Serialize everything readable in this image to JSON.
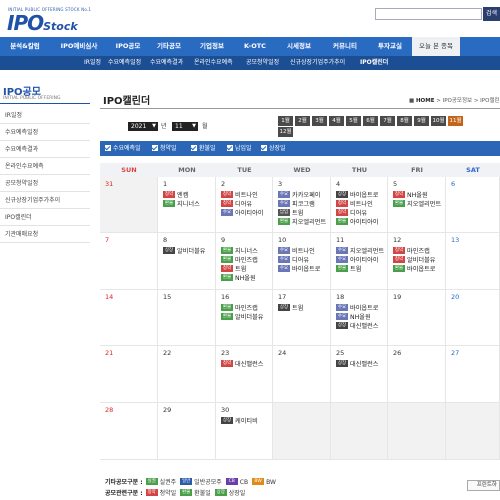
{
  "header": {
    "logo_tag": "INITIAL PUBLIC OFFERING STOCK No.1",
    "logo_ipo": "IPO",
    "logo_stock": "Stock",
    "search_button": "검색"
  },
  "nav": {
    "items": [
      "분석&칼럼",
      "IPO예비심사",
      "IPO공모",
      "기타공모",
      "기업정보",
      "K-OTC",
      "시세정보",
      "커뮤니티",
      "투자교실"
    ],
    "today_label": "오늘 본 종목"
  },
  "subnav": {
    "items": [
      "IR일정",
      "수요예측일정",
      "수요예측결과",
      "온라인수요예측",
      "공모청약일정",
      "신규상장기업주가추이",
      "IPO캘린더"
    ],
    "active_index": 6
  },
  "sidebar": {
    "title": "IPO공모",
    "subtitle": "INITIAL PUBLIC OFFERING",
    "items": [
      "IR일정",
      "수요예측일정",
      "수요예측결과",
      "온라인수요예측",
      "공모청약일정",
      "신규상장기업주가추이",
      "IPO캘린더",
      "기관매매요청"
    ]
  },
  "page": {
    "title": "IPO캘린더",
    "breadcrumb": "HOME > IPO공모정보 > IPO캘린",
    "breadcrumb_home": "HOME",
    "year_value": "2021",
    "year_label": "년",
    "month_value": "11",
    "month_label": "월",
    "months": [
      "1월",
      "2월",
      "3월",
      "4월",
      "5월",
      "6월",
      "7월",
      "8월",
      "9월",
      "10월",
      "11월",
      "12월"
    ],
    "current_month_index": 10
  },
  "filters": [
    {
      "label": "수요예측일",
      "checked": true
    },
    {
      "label": "청약일",
      "checked": true
    },
    {
      "label": "환불일",
      "checked": true
    },
    {
      "label": "납입일",
      "checked": true
    },
    {
      "label": "상장일",
      "checked": true
    }
  ],
  "calendar": {
    "weekdays": [
      "SUN",
      "MON",
      "TUE",
      "WED",
      "THU",
      "FRI",
      "SAT"
    ],
    "tag_colors": {
      "수요": "#6a76b6",
      "청약": "#d24545",
      "환불": "#4aa04a",
      "납입": "#555555",
      "상장": "#444444"
    },
    "weeks": [
      [
        {
          "day": "31",
          "off": true,
          "events": []
        },
        {
          "day": "1",
          "events": [
            {
              "tag": "청약",
              "name": "엔켐"
            },
            {
              "tag": "환불",
              "name": "지니너스"
            }
          ]
        },
        {
          "day": "2",
          "events": [
            {
              "tag": "청약",
              "name": "비트나인"
            },
            {
              "tag": "청약",
              "name": "디어유"
            },
            {
              "tag": "수요",
              "name": "아이티아이"
            }
          ]
        },
        {
          "day": "3",
          "events": [
            {
              "tag": "수요",
              "name": "카카오페이"
            },
            {
              "tag": "수요",
              "name": "피코그램"
            },
            {
              "tag": "납입",
              "name": "트윔"
            },
            {
              "tag": "환불",
              "name": "지오엘리먼트"
            }
          ]
        },
        {
          "day": "4",
          "events": [
            {
              "tag": "상장",
              "name": "바이옵트로"
            },
            {
              "tag": "청약",
              "name": "비트나인"
            },
            {
              "tag": "청약",
              "name": "디어유"
            },
            {
              "tag": "환불",
              "name": "아이티아이"
            }
          ]
        },
        {
          "day": "5",
          "events": [
            {
              "tag": "청약",
              "name": "NH올원"
            },
            {
              "tag": "환불",
              "name": "지오엘리먼트"
            }
          ]
        },
        {
          "day": "6",
          "events": []
        }
      ],
      [
        {
          "day": "7",
          "events": []
        },
        {
          "day": "8",
          "events": [
            {
              "tag": "상장",
              "name": "알비더블유"
            }
          ]
        },
        {
          "day": "9",
          "events": [
            {
              "tag": "환불",
              "name": "지니너스"
            },
            {
              "tag": "환불",
              "name": "마인즈랩"
            },
            {
              "tag": "청약",
              "name": "트윔"
            },
            {
              "tag": "환불",
              "name": "NH올원"
            }
          ]
        },
        {
          "day": "10",
          "events": [
            {
              "tag": "수요",
              "name": "비트나인"
            },
            {
              "tag": "수요",
              "name": "디어유"
            },
            {
              "tag": "수요",
              "name": "바이옵트로"
            }
          ]
        },
        {
          "day": "11",
          "events": [
            {
              "tag": "수요",
              "name": "지오엘리먼트"
            },
            {
              "tag": "수요",
              "name": "아이티아이"
            },
            {
              "tag": "환불",
              "name": "트윔"
            }
          ]
        },
        {
          "day": "12",
          "events": [
            {
              "tag": "청약",
              "name": "마인즈랩"
            },
            {
              "tag": "청약",
              "name": "알비더블유"
            },
            {
              "tag": "환불",
              "name": "바이옵트로"
            }
          ]
        },
        {
          "day": "13",
          "events": []
        }
      ],
      [
        {
          "day": "14",
          "events": []
        },
        {
          "day": "15",
          "events": []
        },
        {
          "day": "16",
          "events": [
            {
              "tag": "환불",
              "name": "마인즈랩"
            },
            {
              "tag": "환불",
              "name": "알비더블유"
            }
          ]
        },
        {
          "day": "17",
          "events": [
            {
              "tag": "상장",
              "name": "트윔"
            }
          ]
        },
        {
          "day": "18",
          "events": [
            {
              "tag": "수요",
              "name": "바이옵트로"
            },
            {
              "tag": "수요",
              "name": "NH올원"
            },
            {
              "tag": "상장",
              "name": "대신밸런스"
            }
          ]
        },
        {
          "day": "19",
          "events": []
        },
        {
          "day": "20",
          "events": []
        }
      ],
      [
        {
          "day": "21",
          "events": []
        },
        {
          "day": "22",
          "events": []
        },
        {
          "day": "23",
          "events": [
            {
              "tag": "청약",
              "name": "대신밸런스"
            }
          ]
        },
        {
          "day": "24",
          "events": []
        },
        {
          "day": "25",
          "events": [
            {
              "tag": "상장",
              "name": "대신밸런스"
            }
          ]
        },
        {
          "day": "26",
          "events": []
        },
        {
          "day": "27",
          "events": []
        }
      ],
      [
        {
          "day": "28",
          "events": []
        },
        {
          "day": "29",
          "events": []
        },
        {
          "day": "30",
          "events": [
            {
              "tag": "상장",
              "name": "케이티비"
            }
          ]
        },
        {
          "day": "",
          "off": true,
          "events": []
        },
        {
          "day": "",
          "off": true,
          "events": []
        },
        {
          "day": "",
          "off": true,
          "events": []
        },
        {
          "day": "",
          "off": true,
          "events": []
        }
      ]
    ]
  },
  "legend": {
    "row1_label": "기타공모구분 :",
    "row1": [
      {
        "tag": "실권",
        "color": "#4aa04a",
        "text": "실권주"
      },
      {
        "tag": "일반",
        "color": "#2a5aa8",
        "text": "일반공모주"
      },
      {
        "tag": "CB",
        "color": "#6a3fa8",
        "text": "CB"
      },
      {
        "tag": "BW",
        "color": "#e08a1a",
        "text": "BW"
      }
    ],
    "row2_label": "공모관련구분 :",
    "row2": [
      {
        "tag": "청약",
        "color": "#d24545",
        "text": "청약일"
      },
      {
        "tag": "환불",
        "color": "#4aa04a",
        "text": "환불일"
      },
      {
        "tag": "상장",
        "color": "#4aa04a",
        "text": "상장일"
      }
    ],
    "print_label": "프린트하"
  }
}
